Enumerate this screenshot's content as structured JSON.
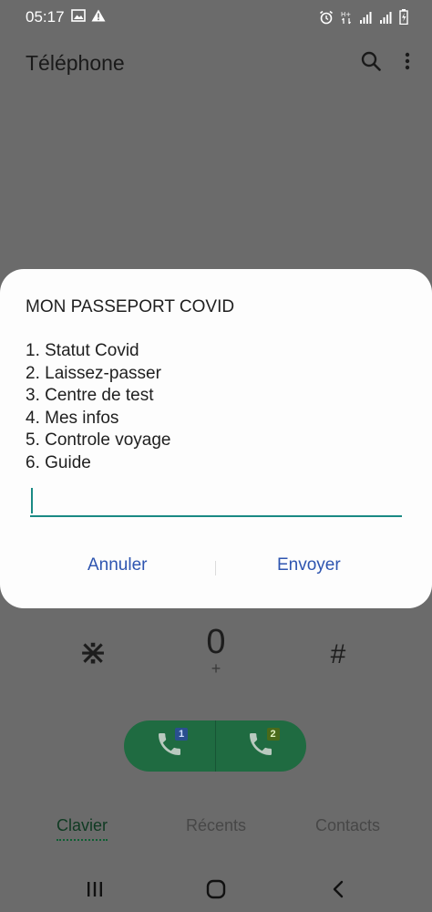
{
  "status_bar": {
    "time": "05:17"
  },
  "app_bar": {
    "title": "Téléphone"
  },
  "dialog": {
    "title": "MON PASSEPORT COVID",
    "menu": [
      "1. Statut Covid",
      "2. Laissez-passer",
      "3. Centre de test",
      "4. Mes infos",
      "5. Controle voyage",
      "6. Guide"
    ],
    "input_value": "",
    "cancel_label": "Annuler",
    "send_label": "Envoyer",
    "accent_color": "#1a8a84",
    "button_color": "#2e55b0"
  },
  "keypad": {
    "star": "⋇",
    "zero": "0",
    "zero_sub": "+",
    "hash": "#"
  },
  "call_buttons": {
    "sim1_badge": "1",
    "sim2_badge": "2"
  },
  "tabs": [
    {
      "label": "Clavier"
    },
    {
      "label": "Récents"
    },
    {
      "label": "Contacts"
    }
  ],
  "icons": {
    "status": [
      "image-icon",
      "alert-icon",
      "alarm-icon",
      "data-icon",
      "signal-icon",
      "signal-icon",
      "battery-icon"
    ],
    "app_bar": [
      "search-icon",
      "more-options-icon"
    ],
    "nav": [
      "recent-apps-icon",
      "home-icon",
      "back-icon"
    ]
  }
}
